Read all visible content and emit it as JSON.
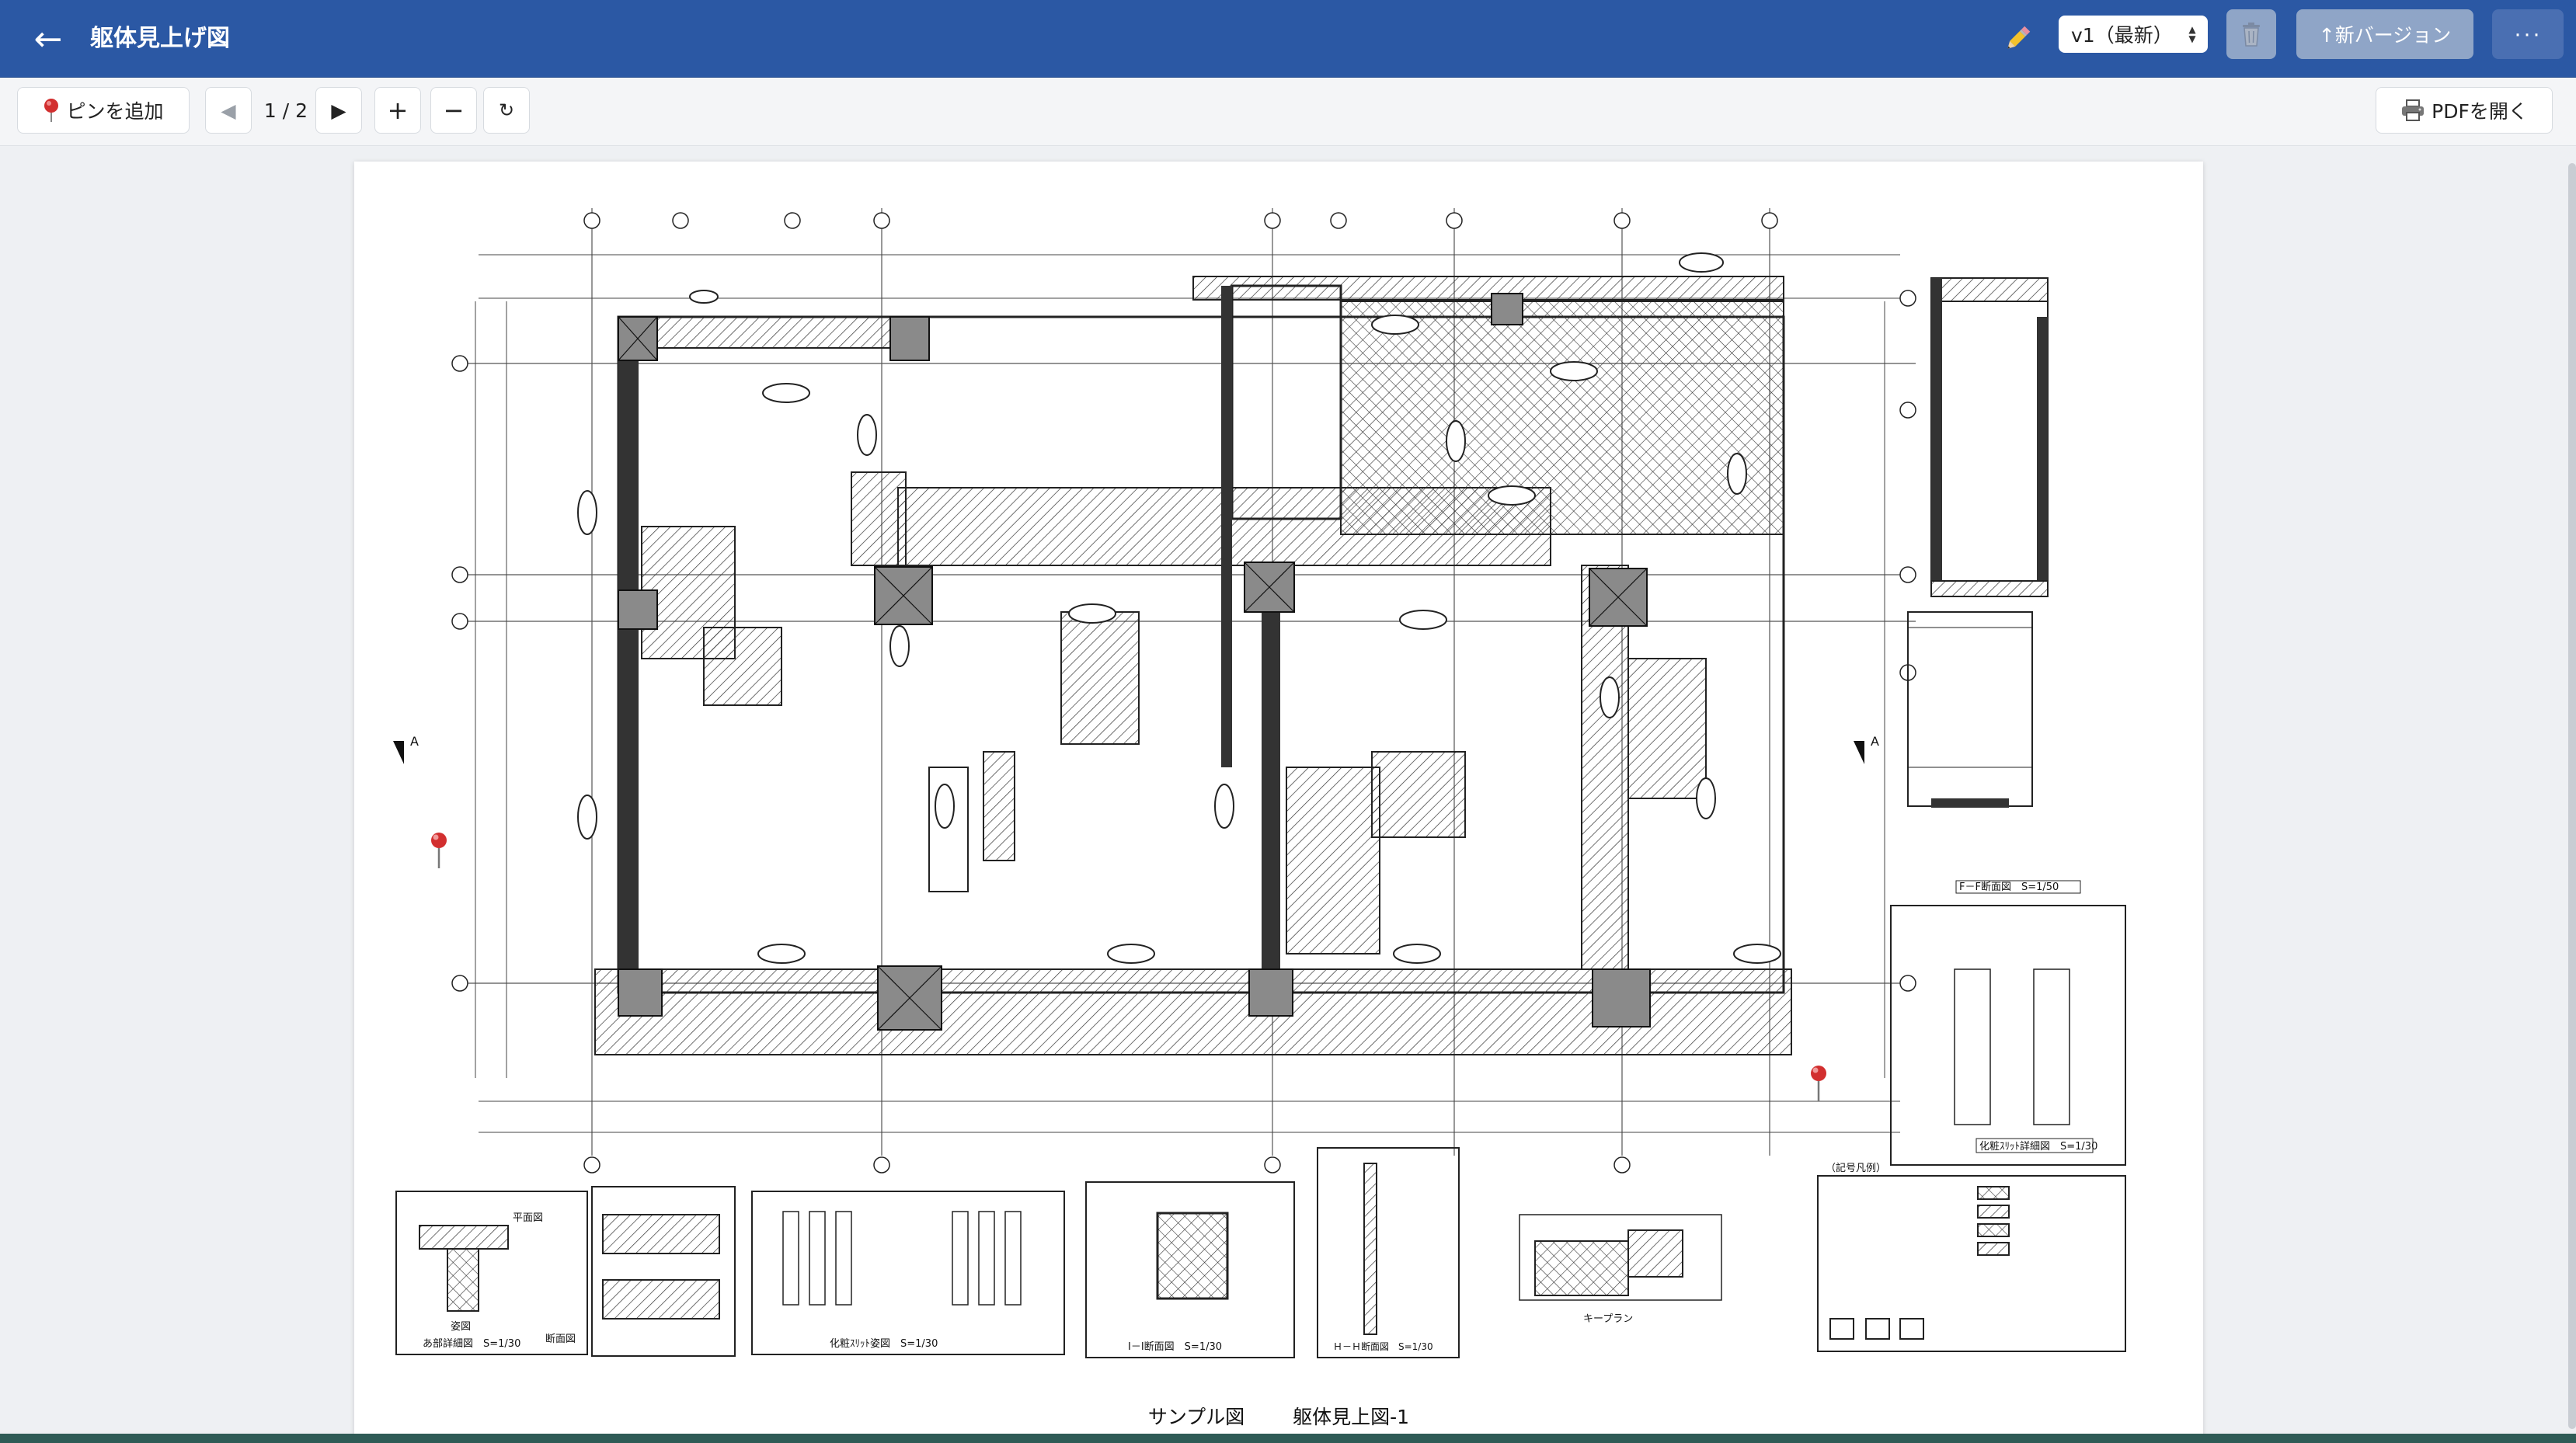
{
  "app": {
    "back_label": "←",
    "title": "躯体見上げ図",
    "version_value": "v1（最新）",
    "new_version_label": "↑新バージョン",
    "more_label": "···"
  },
  "toolbar": {
    "pin_label": "ピンを追加",
    "prev_label": "◀",
    "page_indicator": "1 / 2",
    "next_label": "▶",
    "zoom_in_label": "+",
    "zoom_out_label": "−",
    "reset_label": "↻",
    "open_pdf_label": "PDFを開く"
  },
  "drawing": {
    "caption_left": "サンプル図",
    "caption_right": "躯体見上図-1",
    "section_ff": "F－F断面図　S=1/50",
    "section_slit": "化粧ｽﾘｯﾄ詳細図　S=1/30",
    "detail_a": "あ部詳細図　S=1/30",
    "detail_slit_elev": "化粧ｽﾘｯﾄ姿図　S=1/30",
    "detail_ii": "Ⅰ－Ⅰ断面図　S=1/30",
    "detail_hh": "Ｈ－Ｈ断面図　S=1/30",
    "key_plan": "キープラン",
    "legend_title": "（記号凡例）",
    "label_elev": "姿図",
    "label_plan": "平面図",
    "label_section": "断面図"
  },
  "icons": {
    "back": "arrow-left-icon",
    "edit": "pencil-icon",
    "trash": "trash-icon",
    "pin": "map-pin-icon",
    "printer": "printer-icon"
  },
  "colors": {
    "header_bg": "#2b58a4",
    "header_btn": "#8fa5c7",
    "pin_red": "#d22f2f"
  }
}
